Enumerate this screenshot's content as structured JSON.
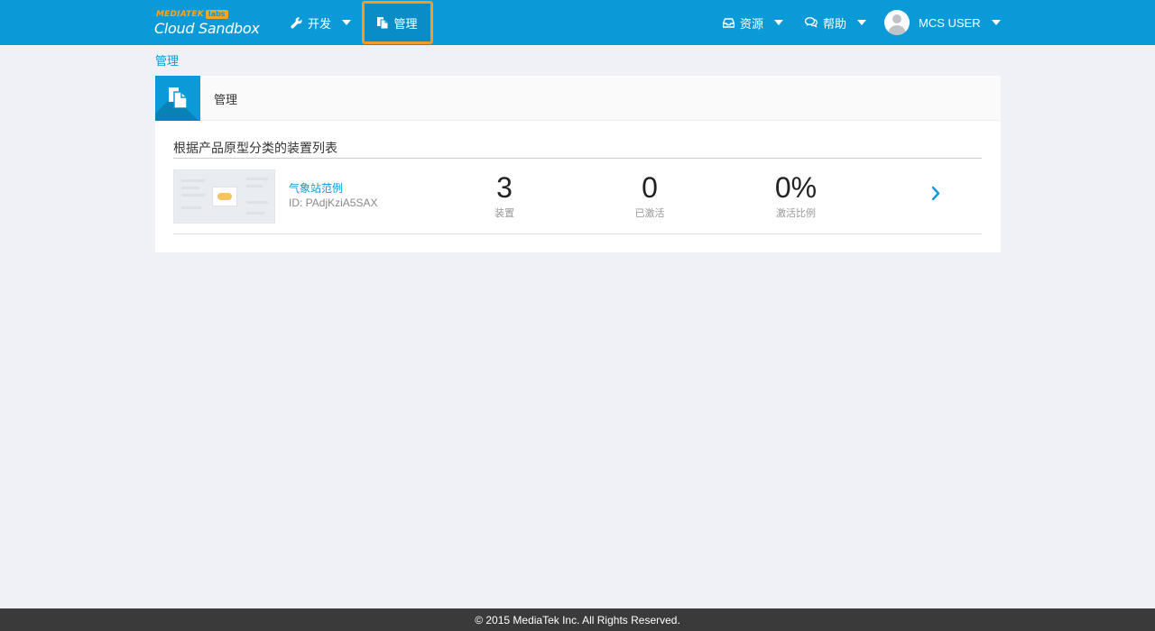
{
  "brand": {
    "top_text": "MEDIATEK",
    "labs_text": "labs",
    "name": "Cloud Sandbox"
  },
  "nav": {
    "develop": "开发",
    "manage": "管理",
    "resources": "资源",
    "help": "帮助",
    "user": "MCS USER"
  },
  "breadcrumb": "管理",
  "panel": {
    "title": "管理",
    "section_title": "根据产品原型分类的装置列表",
    "prototypes": [
      {
        "name": "气象站范例",
        "id_text": "ID: PAdjKziA5SAX",
        "devices": "3",
        "devices_label": "装置",
        "activated": "0",
        "activated_label": "已激活",
        "activation_rate": "0%",
        "activation_rate_label": "激活比例"
      }
    ]
  },
  "footer": "© 2015 MediaTek Inc. All Rights Reserved.",
  "colors": {
    "brand_blue": "#0a9ad7",
    "highlight_orange": "#f29b26",
    "footer_bg": "#3a3a3a"
  }
}
